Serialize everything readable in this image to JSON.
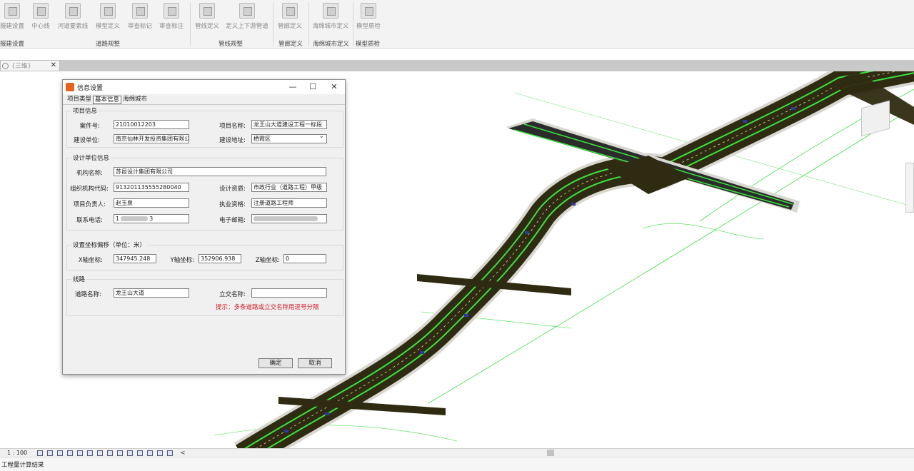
{
  "ribbon": {
    "buttons": [
      {
        "label": "报建设置"
      },
      {
        "label": "中心线"
      },
      {
        "label": "河道要素线"
      },
      {
        "label": "模型定义"
      },
      {
        "label": "审查标记"
      },
      {
        "label": "审查标注"
      },
      {
        "label": "管线定义"
      },
      {
        "label": "定义上下游管道"
      },
      {
        "label": "管廊定义"
      },
      {
        "label": "海绵城市定义"
      },
      {
        "label": "模型质检"
      }
    ],
    "groups": [
      "报建设置",
      "道路规整",
      "管线规整",
      "管廊定义",
      "海绵城市定义",
      "模型质检"
    ]
  },
  "view_tab": {
    "label": "{三维}",
    "close": "✕"
  },
  "dialog": {
    "title": "信息设置",
    "minimize": "—",
    "maximize": "☐",
    "close": "✕",
    "tabs": [
      "项目类型",
      "基本信息",
      "海绵城市"
    ],
    "project_info": {
      "title": "项目信息",
      "case_no_label": "案件号:",
      "case_no": "21010012203",
      "project_name_label": "项目名称:",
      "project_name": "龙王山大道建设工程一标段",
      "builder_label": "建设单位:",
      "builder": "南京仙林开发投资集团有限公",
      "address_label": "建设地址:",
      "address": "栖霞区"
    },
    "design_unit": {
      "title": "设计单位信息",
      "org_name_label": "机构名称:",
      "org_name": "苏邑设计集团有限公司",
      "org_code_label": "组织机构代码:",
      "org_code": "913201135555280040",
      "qualification_label": "设计资质:",
      "qualification": "市政行业（道路工程）甲级",
      "leader_label": "项目负责人:",
      "leader": "赵玉泉",
      "license_label": "执业资格:",
      "license": "注册道路工程师",
      "phone_label": "联系电话:",
      "phone_prefix": "1",
      "phone_suffix": "3",
      "email_label": "电子邮箱:"
    },
    "coords": {
      "title": "设置坐标偏移（单位：米）",
      "x_label": "X轴坐标:",
      "x": "347945.248",
      "y_label": "Y轴坐标:",
      "y": "352906.938",
      "z_label": "Z轴坐标:",
      "z": "0"
    },
    "road": {
      "title": "线路",
      "road_name_label": "道路名称:",
      "road_name": "龙王山大道",
      "interchange_label": "立交名称:",
      "interchange": "",
      "hint": "提示：多条道路或立交名称用逗号分隔"
    },
    "ok": "确定",
    "cancel": "取消"
  },
  "status": {
    "scale": "1 : 100",
    "arrow": "<",
    "bottom_text": "工程量计算结果"
  },
  "colors": {
    "road": "#2f2b12",
    "lane_line": "#3be03f",
    "hint": "#d0202a",
    "app_icon": "#e8631b"
  }
}
